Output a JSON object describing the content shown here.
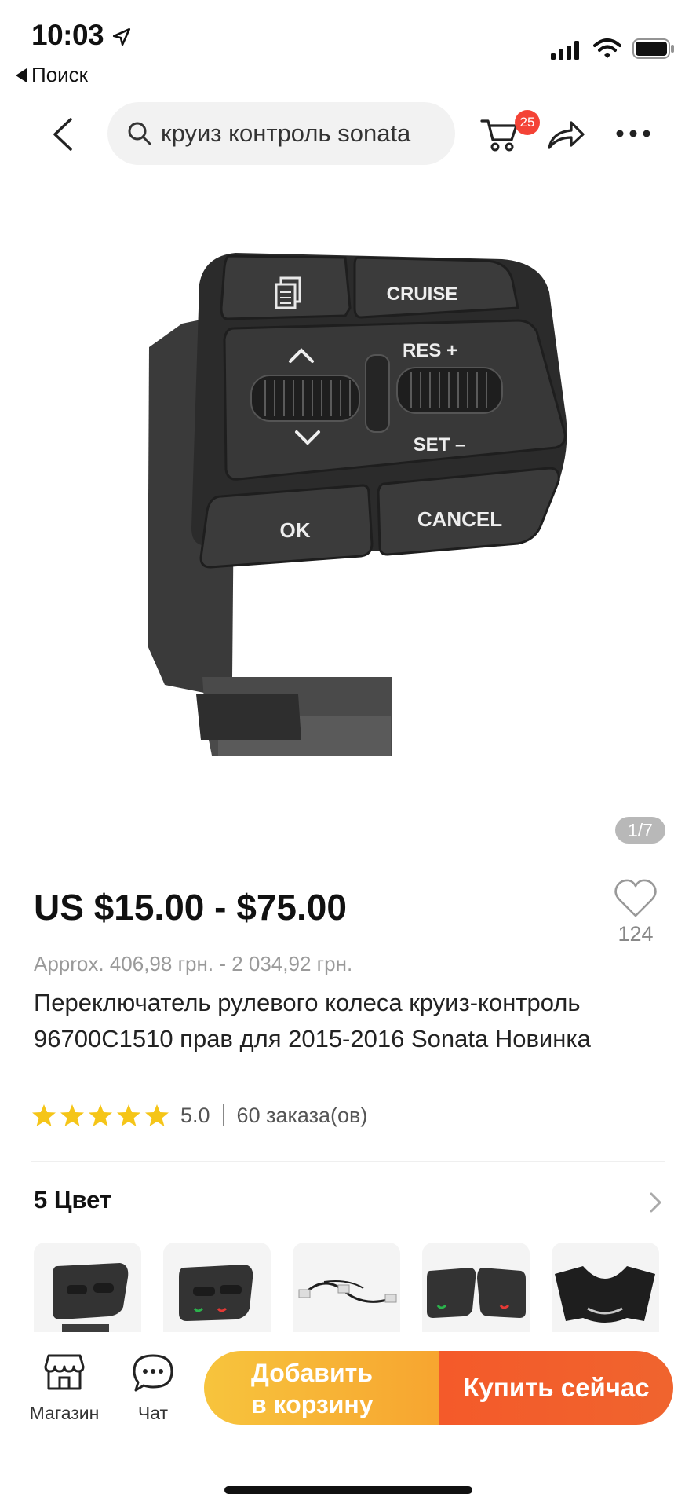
{
  "status_bar": {
    "time": "10:03",
    "back_app_label": "Поиск",
    "icons": [
      "location-arrow-icon",
      "cellular-signal-icon",
      "wifi-icon",
      "battery-icon"
    ]
  },
  "nav": {
    "search_text": "круиз контроль sonata",
    "cart_badge": "25",
    "icons": [
      "back-chevron-icon",
      "search-icon",
      "cart-icon",
      "share-icon",
      "more-icon"
    ]
  },
  "gallery": {
    "counter": "1/7",
    "product_button_labels": [
      "CRUISE",
      "RES +",
      "SET –",
      "OK",
      "CANCEL"
    ]
  },
  "product": {
    "price": "US $15.00 - $75.00",
    "wishlist_count": "124",
    "approx_price": "Approx. 406,98 грн. - 2 034,92 грн.",
    "title": "Переключатель рулевого колеса круиз-контроль 96700C1510 прав для 2015-2016 Sonata Новинка",
    "rating": 5.0,
    "rating_text": "5.0",
    "orders": "60 заказа(ов)"
  },
  "colors": {
    "heading": "5 Цвет",
    "count": 5
  },
  "bottom_bar": {
    "shop_label": "Магазин",
    "chat_label": "Чат",
    "add_to_cart_line1": "Добавить",
    "add_to_cart_line2": "в корзину",
    "buy_now_label": "Купить сейчас"
  },
  "colors_palette": {
    "accent_orange": "#f45a2a",
    "accent_yellow": "#f7b73a",
    "badge_red": "#f44336",
    "star_yellow": "#f5c518"
  }
}
